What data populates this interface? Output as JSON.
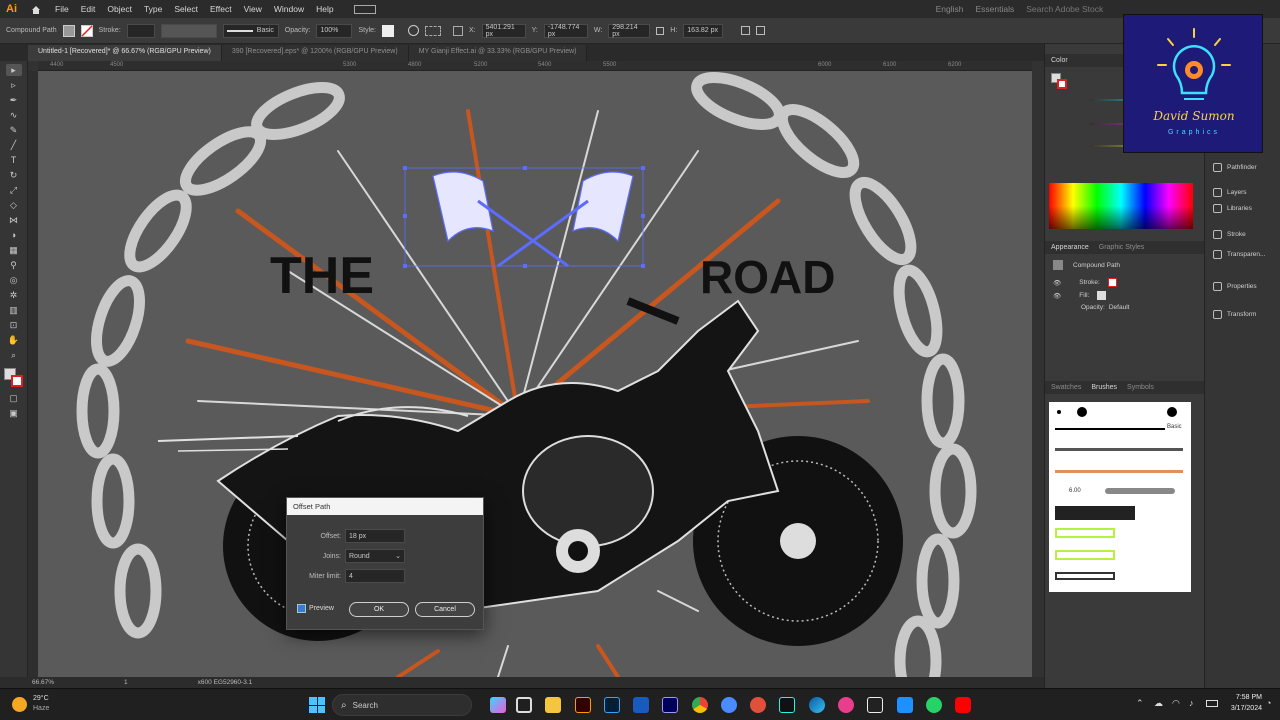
{
  "app": {
    "logo": "Ai"
  },
  "menu": [
    "File",
    "Edit",
    "Object",
    "Type",
    "Select",
    "Effect",
    "View",
    "Window",
    "Help"
  ],
  "menu_right": [
    "English",
    "Essentials",
    "Search Adobe Stock"
  ],
  "control_bar": {
    "selection": "Compound Path",
    "stroke_label": "Stroke:",
    "brush_label": "Basic",
    "opacity_label": "Opacity:",
    "opacity_value": "100%",
    "style_label": "Style:",
    "x_label": "X:",
    "x_value": "5401.291 px",
    "y_label": "Y:",
    "y_value": "-1748.774 px",
    "w_label": "W:",
    "w_value": "298.214 px",
    "h_label": "H:",
    "h_value": "163.82 px"
  },
  "tabs": [
    {
      "label": "Untitled-1 [Recovered]* @ 66.67% (RGB/GPU Preview)",
      "active": true
    },
    {
      "label": "390 [Recovered].eps* @ 1200% (RGB/GPU Preview)",
      "active": false
    },
    {
      "label": "MY Gianji Effect.ai @ 33.33% (RGB/GPU Preview)",
      "active": false
    }
  ],
  "ruler_top": [
    "4400",
    "4500",
    "5300",
    "4800",
    "5200",
    "5400",
    "5500",
    "6000",
    "6100",
    "6200"
  ],
  "artwork": {
    "word_left": "THE",
    "word_right": "ROAD"
  },
  "status": {
    "zoom": "66.67%",
    "artboard": "1",
    "info": "x600 EG52960-3.1"
  },
  "dialog": {
    "title": "Offset Path",
    "offset_label": "Offset:",
    "offset_value": "18 px",
    "joins_label": "Joins:",
    "joins_value": "Round",
    "miter_label": "Miter limit:",
    "miter_value": "4",
    "preview_label": "Preview",
    "ok_label": "OK",
    "cancel_label": "Cancel"
  },
  "color_panel": {
    "title": "Color"
  },
  "appearance_panel": {
    "tabs": [
      "Appearance",
      "Graphic Styles"
    ],
    "object": "Compound Path",
    "stroke_label": "Stroke:",
    "fill_label": "Fill:",
    "opacity_label": "Opacity:",
    "opacity_value": "Default"
  },
  "brushes_panel": {
    "tabs": [
      "Swatches",
      "Brushes",
      "Symbols"
    ],
    "basic_label": "Basic",
    "brush_size": "6.00"
  },
  "dock": [
    "Pathfinder",
    "Layers",
    "Libraries",
    "Stroke",
    "Transparen...",
    "Properties",
    "Transform"
  ],
  "logo": {
    "line1": "David Sumon",
    "line2": "Graphics"
  },
  "taskbar": {
    "weather_temp": "29°C",
    "weather_desc": "Haze",
    "search_label": "Search",
    "time": "7:58 PM",
    "date": "3/17/2024"
  },
  "colors": {
    "accent_orange": "#c8561f",
    "chain": "#c9c9c9",
    "flag_select": "#5b6cff",
    "canvas": "#5a5a5a"
  }
}
